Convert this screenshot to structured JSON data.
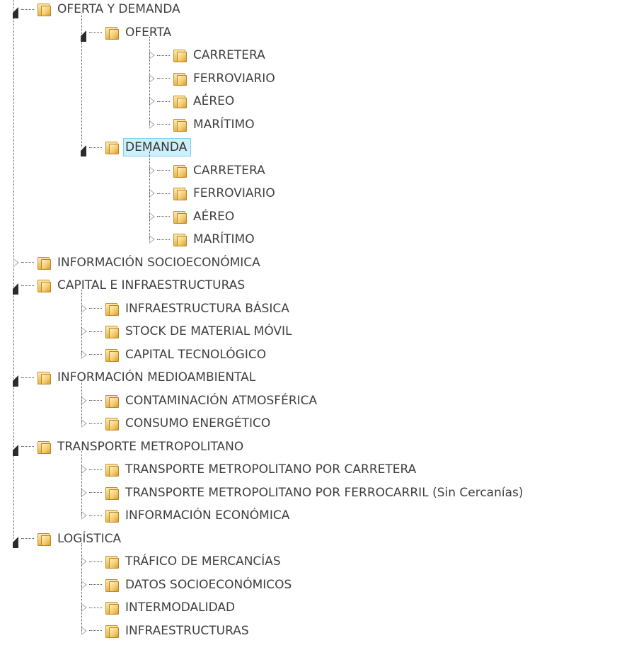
{
  "tree": [
    {
      "label": "OFERTA Y DEMANDA",
      "expanded": true,
      "children": [
        {
          "label": "OFERTA",
          "expanded": true,
          "children": [
            {
              "label": "CARRETERA"
            },
            {
              "label": "FERROVIARIO"
            },
            {
              "label": "AÉREO"
            },
            {
              "label": "MARÍTIMO"
            }
          ]
        },
        {
          "label": "DEMANDA",
          "expanded": true,
          "selected": true,
          "children": [
            {
              "label": "CARRETERA"
            },
            {
              "label": "FERROVIARIO"
            },
            {
              "label": "AÉREO"
            },
            {
              "label": "MARÍTIMO"
            }
          ]
        }
      ]
    },
    {
      "label": "INFORMACIÓN SOCIOECONÓMICA",
      "expanded": false
    },
    {
      "label": "CAPITAL E INFRAESTRUCTURAS",
      "expanded": true,
      "children": [
        {
          "label": "INFRAESTRUCTURA BÁSICA"
        },
        {
          "label": "STOCK DE MATERIAL MÓVIL"
        },
        {
          "label": "CAPITAL TECNOLÓGICO"
        }
      ]
    },
    {
      "label": "INFORMACIÓN MEDIOAMBIENTAL",
      "expanded": true,
      "children": [
        {
          "label": "CONTAMINACIÓN ATMOSFÉRICA"
        },
        {
          "label": "CONSUMO ENERGÉTICO"
        }
      ]
    },
    {
      "label": "TRANSPORTE METROPOLITANO",
      "expanded": true,
      "children": [
        {
          "label": "TRANSPORTE METROPOLITANO POR CARRETERA"
        },
        {
          "label": "TRANSPORTE METROPOLITANO POR FERROCARRIL (Sin Cercanías)"
        },
        {
          "label": "INFORMACIÓN ECONÓMICA"
        }
      ]
    },
    {
      "label": "LOGÍSTICA",
      "expanded": true,
      "children": [
        {
          "label": "TRÁFICO DE MERCANCÍAS"
        },
        {
          "label": "DATOS SOCIOECONÓMICOS"
        },
        {
          "label": "INTERMODALIDAD"
        },
        {
          "label": "INFRAESTRUCTURAS"
        }
      ]
    }
  ],
  "icons": {
    "folder": "folder-icon",
    "expanded": "expanded-arrow-icon",
    "collapsed": "collapsed-arrow-icon"
  },
  "colors": {
    "selection_bg": "#cdeffc",
    "selection_border": "#7fd0ef",
    "text": "#3f3f3f"
  }
}
